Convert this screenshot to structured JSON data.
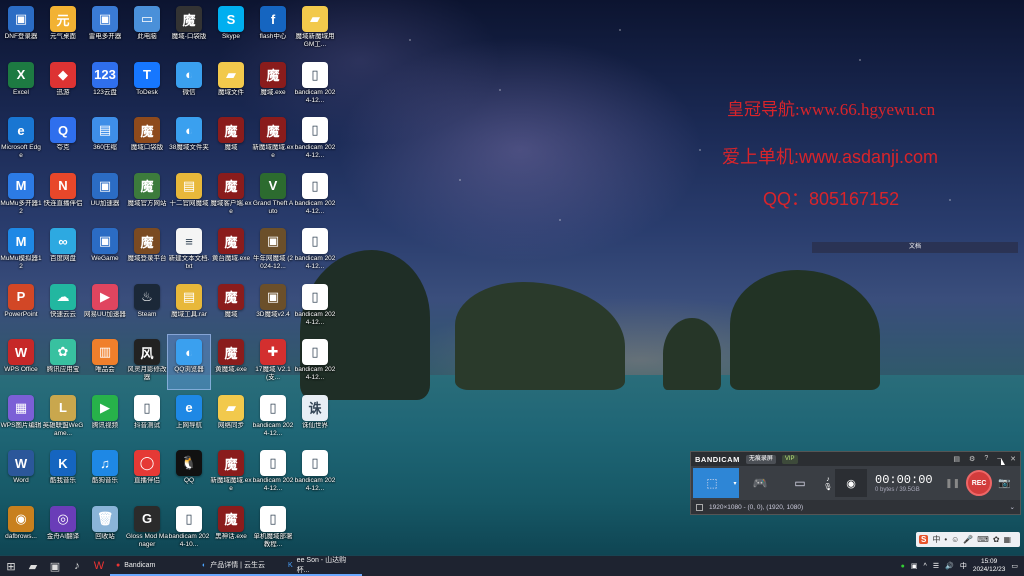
{
  "desktop": {
    "icons": [
      {
        "label": "DNF登录器",
        "color": "#2b6cc4",
        "glyph": "▣",
        "name": "dnf-launcher-icon"
      },
      {
        "label": "Excel",
        "color": "#1d7a42",
        "glyph": "X",
        "name": "excel-icon"
      },
      {
        "label": "Microsoft Edge",
        "color": "#1976d2",
        "glyph": "e",
        "name": "edge-icon"
      },
      {
        "label": "MuMu多开器12",
        "color": "#2c7be5",
        "glyph": "M",
        "name": "mumu-multi-icon"
      },
      {
        "label": "MuMu模拟器12",
        "color": "#1e88e5",
        "glyph": "M",
        "name": "mumu-emulator-icon"
      },
      {
        "label": "PowerPoint",
        "color": "#d24726",
        "glyph": "P",
        "name": "powerpoint-icon"
      },
      {
        "label": "WPS Office",
        "color": "#c62828",
        "glyph": "W",
        "name": "wps-office-icon"
      },
      {
        "label": "WPS图片编辑",
        "color": "#7b5fd6",
        "glyph": "▦",
        "name": "wps-image-icon"
      },
      {
        "label": "Word",
        "color": "#2b579a",
        "glyph": "W",
        "name": "word-icon"
      },
      {
        "label": "dafbrows...",
        "color": "#c8801e",
        "glyph": "◉",
        "name": "browser-icon"
      },
      {
        "label": "元气桌面",
        "color": "#f2b233",
        "glyph": "元",
        "name": "yuanqi-desktop-icon"
      },
      {
        "label": "迅游",
        "color": "#d33",
        "glyph": "◆",
        "name": "xunyou-icon"
      },
      {
        "label": "夸克",
        "color": "#2f6fed",
        "glyph": "Q",
        "name": "quark-icon"
      },
      {
        "label": "快连直播伴侣",
        "color": "#e8472a",
        "glyph": "N",
        "name": "live-companion-icon"
      },
      {
        "label": "百度网盘",
        "color": "#2da9e1",
        "glyph": "∞",
        "name": "baidu-pan-icon"
      },
      {
        "label": "快速云云",
        "color": "#22b7a0",
        "glyph": "☁",
        "name": "cloud-icon"
      },
      {
        "label": "腾讯应用宝",
        "color": "#38c1a0",
        "glyph": "✿",
        "name": "tencent-app-icon"
      },
      {
        "label": "英雄联盟WeGame...",
        "color": "#c9a74d",
        "glyph": "L",
        "name": "lol-wegame-icon"
      },
      {
        "label": "酷我音乐",
        "color": "#1565c0",
        "glyph": "K",
        "name": "kuwo-music-icon"
      },
      {
        "label": "金舟AI翻译",
        "color": "#6a3db8",
        "glyph": "◎",
        "name": "ai-translate-icon"
      },
      {
        "label": "雷电多开器",
        "color": "#3a7bd5",
        "glyph": "▣",
        "name": "ld-multi-icon"
      },
      {
        "label": "123云盘",
        "color": "#2f6fed",
        "glyph": "123",
        "name": "123pan-icon"
      },
      {
        "label": "360压缩",
        "color": "#3e8ee8",
        "glyph": "▤",
        "name": "360zip-icon"
      },
      {
        "label": "UU加速器",
        "color": "#2b6cc4",
        "glyph": "▣",
        "name": "uu-accelerator-icon"
      },
      {
        "label": "WeGame",
        "color": "#2b6cc4",
        "glyph": "▣",
        "name": "wegame-icon"
      },
      {
        "label": "网易UU加速器",
        "color": "#e0455f",
        "glyph": "▶",
        "name": "netease-uu-icon"
      },
      {
        "label": "唯品会",
        "color": "#f07f2b",
        "glyph": "▥",
        "name": "vip-shop-icon"
      },
      {
        "label": "腾讯视频",
        "color": "#27b24a",
        "glyph": "▶",
        "name": "tencent-video-icon"
      },
      {
        "label": "酷狗音乐",
        "color": "#1e88e5",
        "glyph": "♫",
        "name": "kugou-icon"
      },
      {
        "label": "回收站",
        "color": "#8ab4d8",
        "glyph": "🗑",
        "name": "recycle-bin-icon"
      },
      {
        "label": "此电脑",
        "color": "#4a90d9",
        "glyph": "▭",
        "name": "this-pc-icon"
      },
      {
        "label": "ToDesk",
        "color": "#1677ff",
        "glyph": "T",
        "name": "todesk-icon"
      },
      {
        "label": "魔域口袋版",
        "color": "#8e4a1c",
        "glyph": "魔",
        "name": "moyu-pocket-icon"
      },
      {
        "label": "魔域官方网站",
        "color": "#3c7b3c",
        "glyph": "魔",
        "name": "moyu-site-icon"
      },
      {
        "label": "魔域登录平台",
        "color": "#7a4a22",
        "glyph": "魔",
        "name": "moyu-login-icon"
      },
      {
        "label": "Steam",
        "color": "#1b2838",
        "glyph": "♨",
        "name": "steam-icon"
      },
      {
        "label": "风灵月影修改器",
        "color": "#222",
        "glyph": "风",
        "name": "trainer-icon"
      },
      {
        "label": "抖音测试",
        "color": "#fff",
        "glyph": "▯",
        "name": "douyin-file-icon"
      },
      {
        "label": "直播伴侣",
        "color": "#e53935",
        "glyph": "◯",
        "name": "live-assistant-icon"
      },
      {
        "label": "Gloss Mod Manager",
        "color": "#2b2b2b",
        "glyph": "G",
        "name": "gloss-mod-icon"
      },
      {
        "label": "魔域-口袋版",
        "color": "#333",
        "glyph": "魔",
        "name": "moyu-game-icon"
      },
      {
        "label": "微信",
        "color": "#3aa0ef",
        "glyph": "◐",
        "name": "wechat-app-icon"
      },
      {
        "label": "38魔域文件夹",
        "color": "#3aa0ef",
        "glyph": "◐",
        "name": "moyu-folder-app-icon"
      },
      {
        "label": "十二官网魔域",
        "color": "#e8b83a",
        "glyph": "▤",
        "name": "moyu-archive-icon"
      },
      {
        "label": "新建文本文档.txt",
        "color": "#f5f5f5",
        "glyph": "≡",
        "name": "text-file-icon"
      },
      {
        "label": "魔域工具.rar",
        "color": "#e8b83a",
        "glyph": "▤",
        "name": "rar-file-icon"
      },
      {
        "label": "QQ浏览器",
        "color": "#3aa0ef",
        "glyph": "◐",
        "name": "qq-browser-icon"
      },
      {
        "label": "上网导航",
        "color": "#1e88e5",
        "glyph": "e",
        "name": "ie-icon"
      },
      {
        "label": "QQ",
        "color": "#111",
        "glyph": "🐧",
        "name": "qq-icon"
      },
      {
        "label": "bandicam 2024-10...",
        "color": "#fff",
        "glyph": "▯",
        "name": "bandicam-file-1-icon"
      },
      {
        "label": "Skype",
        "color": "#00aff0",
        "glyph": "S",
        "name": "skype-icon"
      },
      {
        "label": "魔域文件",
        "color": "#f2c94c",
        "glyph": "▰",
        "name": "moyu-folder-icon"
      },
      {
        "label": "魔域",
        "color": "#8a1c1c",
        "glyph": "魔",
        "name": "moyu-exe-1-icon"
      },
      {
        "label": "魔域客户端.exe",
        "color": "#8a1c1c",
        "glyph": "魔",
        "name": "moyu-exe-2-icon"
      },
      {
        "label": "黄台魔域.exe",
        "color": "#8a1c1c",
        "glyph": "魔",
        "name": "moyu-exe-3-icon"
      },
      {
        "label": "魔域",
        "color": "#8a1c1c",
        "glyph": "魔",
        "name": "moyu-exe-4-icon"
      },
      {
        "label": "黄魔域.exe",
        "color": "#8a1c1c",
        "glyph": "魔",
        "name": "moyu-exe-5-icon"
      },
      {
        "label": "网络同步",
        "color": "#f2c94c",
        "glyph": "▰",
        "name": "sync-folder-icon"
      },
      {
        "label": "新魔域魔域.exe",
        "color": "#8a1c1c",
        "glyph": "魔",
        "name": "moyu-exe-6-icon"
      },
      {
        "label": "黑神话.exe",
        "color": "#8a1c1c",
        "glyph": "魔",
        "name": "moyu-exe-7-icon"
      },
      {
        "label": "flash中心",
        "color": "#1565c0",
        "glyph": "f",
        "name": "flash-center-icon"
      },
      {
        "label": "魔域.exe",
        "color": "#8a1c1c",
        "glyph": "魔",
        "name": "moyu-exe-8-icon"
      },
      {
        "label": "新魔域魔域.exe",
        "color": "#8a1c1c",
        "glyph": "魔",
        "name": "moyu-exe-9-icon"
      },
      {
        "label": "Grand Theft Auto",
        "color": "#2c6b2f",
        "glyph": "V",
        "name": "gta-icon"
      },
      {
        "label": "牛年网魔域 (2024-12...",
        "color": "#6b4f2a",
        "glyph": "▣",
        "name": "video-thumb-1-icon"
      },
      {
        "label": "3D魔域v2.4",
        "color": "#6b4f2a",
        "glyph": "▣",
        "name": "video-thumb-2-icon"
      },
      {
        "label": "17魔域 V2.1(支...",
        "color": "#d32f2f",
        "glyph": "✚",
        "name": "plus-app-icon"
      },
      {
        "label": "bandicam 2024-12...",
        "color": "#fff",
        "glyph": "▯",
        "name": "bandicam-file-2-icon"
      },
      {
        "label": "bandicam 2024-12...",
        "color": "#fff",
        "glyph": "▯",
        "name": "bandicam-file-3-icon"
      },
      {
        "label": "单机魔域部署教程...",
        "color": "#fff",
        "glyph": "▯",
        "name": "tutorial-file-icon"
      },
      {
        "label": "魔域新魔域用GM工...",
        "color": "#f2c94c",
        "glyph": "▰",
        "name": "gm-tool-folder-icon"
      },
      {
        "label": "bandicam 2024-12...",
        "color": "#fff",
        "glyph": "▯",
        "name": "bandicam-file-4-icon"
      },
      {
        "label": "bandicam 2024-12...",
        "color": "#fff",
        "glyph": "▯",
        "name": "bandicam-file-5-icon"
      },
      {
        "label": "bandicam 2024-12...",
        "color": "#fff",
        "glyph": "▯",
        "name": "bandicam-file-6-icon"
      },
      {
        "label": "bandicam 2024-12...",
        "color": "#fff",
        "glyph": "▯",
        "name": "bandicam-file-7-icon"
      },
      {
        "label": "bandicam 2024-12...",
        "color": "#fff",
        "glyph": "▯",
        "name": "bandicam-file-8-icon"
      },
      {
        "label": "bandicam 2024-12...",
        "color": "#fff",
        "glyph": "▯",
        "name": "bandicam-file-9-icon"
      },
      {
        "label": "诛仙世界",
        "color": "#e7eef5",
        "glyph": "诛",
        "name": "zhuxian-icon"
      },
      {
        "label": "bandicam 2024-12...",
        "color": "#fff",
        "glyph": "▯",
        "name": "bandicam-file-10-icon"
      }
    ]
  },
  "watermark": {
    "line1": "皇冠导航:www.66.hgyewu.cn",
    "line2": "爱上单机:www.asdanji.com",
    "line3": "QQ：805167152",
    "color": "#d9242a"
  },
  "top_bar_text": "文档",
  "bandicam": {
    "logo": "BANDICAM",
    "tag1": "无痕录屏",
    "vip": "VIP",
    "time": "00:00:00",
    "size": "0 bytes / 39.5GB",
    "rec_label": "REC",
    "footer_text": "1920×1080 - (0, 0), (1920, 1080)",
    "accent": "#2e86d6"
  },
  "taskbar": {
    "apps": [
      {
        "label": "Bandicam",
        "name": "taskbar-bandicam"
      },
      {
        "label": "产品详情 | 云生云",
        "name": "taskbar-browser"
      },
      {
        "label": "ee Son - 山达购杯...",
        "name": "taskbar-kugou"
      }
    ],
    "ime": "中",
    "time": "15:09",
    "date": "2024/12/23"
  }
}
